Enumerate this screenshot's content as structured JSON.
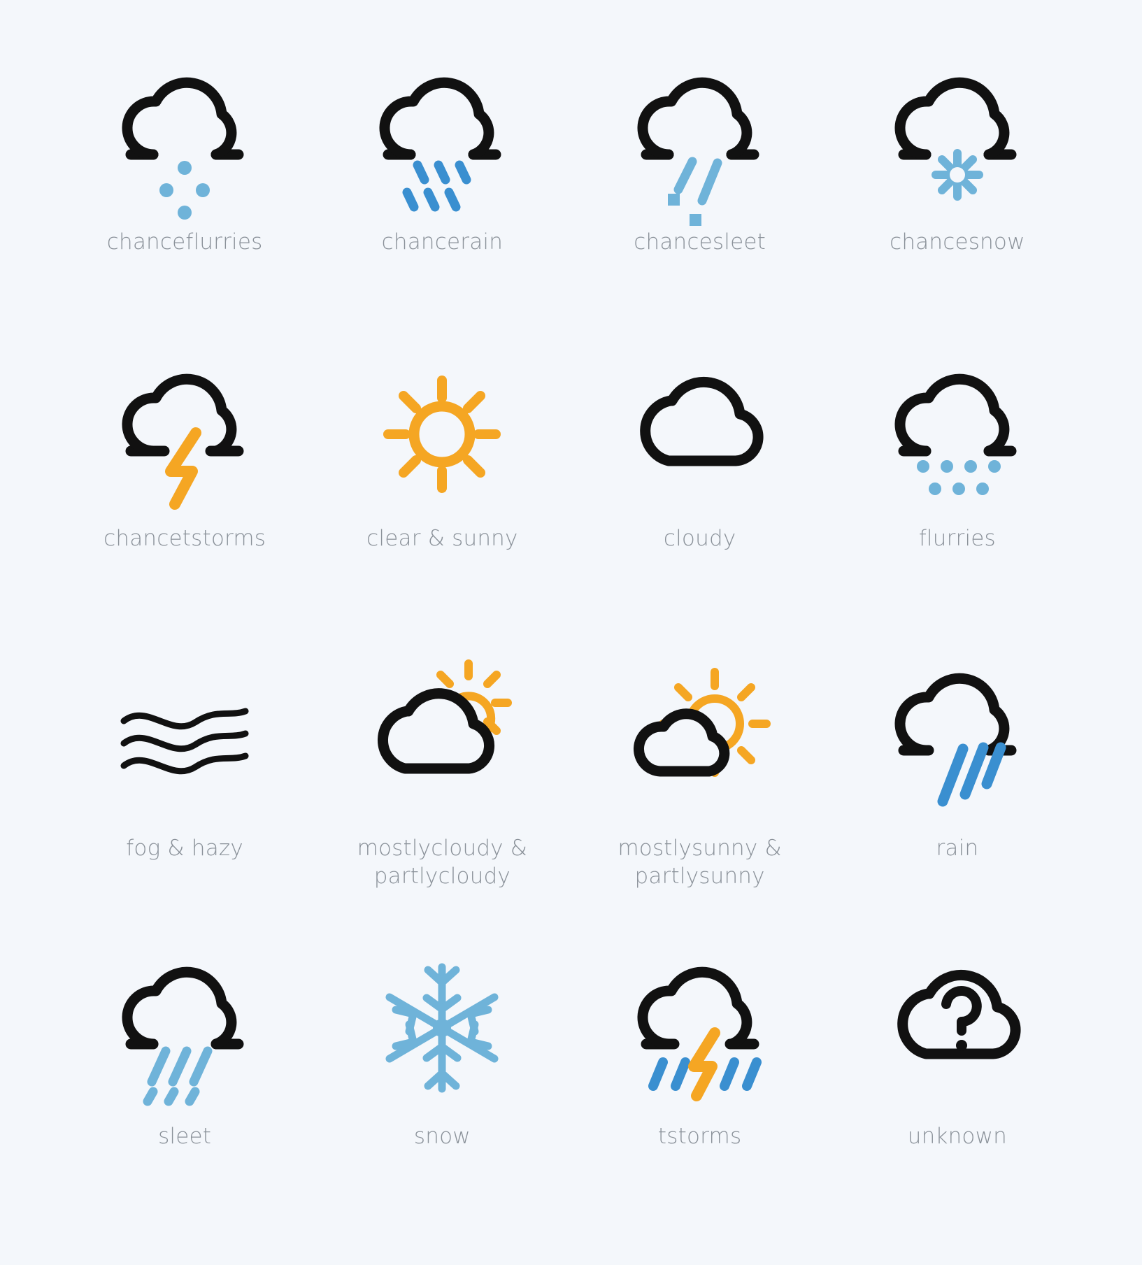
{
  "page": {
    "title": "Weather icon set",
    "background_color": "#f4f7fb",
    "label_color": "#8a9199",
    "columns": 4,
    "rows": 4,
    "icon_count": 16
  },
  "colors": {
    "outline": "#111111",
    "rain_blue": "#3a8fd0",
    "snow_blue": "#6fb3d9",
    "sun_amber": "#f5a623",
    "bolt_amber": "#f5a623",
    "label_gray": "#8a9199",
    "background": "#f4f7fb"
  },
  "icons": [
    {
      "id": "chanceflurries",
      "label": "chanceflurries",
      "label_lines": [
        "chanceflurries"
      ],
      "glyph": "cloud-with-snow-dots-icon",
      "accent": "#6fb3d9"
    },
    {
      "id": "chancerain",
      "label": "chancerain",
      "label_lines": [
        "chancerain"
      ],
      "glyph": "cloud-with-rain-dashes-icon",
      "accent": "#3a8fd0"
    },
    {
      "id": "chancesleet",
      "label": "chancesleet",
      "label_lines": [
        "chancesleet"
      ],
      "glyph": "cloud-with-sleet-icon",
      "accent": "#6fb3d9"
    },
    {
      "id": "chancesnow",
      "label": "chancesnow",
      "label_lines": [
        "chancesnow"
      ],
      "glyph": "cloud-with-small-snowflake-icon",
      "accent": "#6fb3d9"
    },
    {
      "id": "chancetstorms",
      "label": "chancetstorms",
      "label_lines": [
        "chancetstorms"
      ],
      "glyph": "cloud-with-lightning-icon",
      "accent": "#f5a623"
    },
    {
      "id": "clear",
      "label": "clear & sunny",
      "label_lines": [
        "clear & sunny"
      ],
      "glyph": "sun-icon",
      "accent": "#f5a623"
    },
    {
      "id": "cloudy",
      "label": "cloudy",
      "label_lines": [
        "cloudy"
      ],
      "glyph": "cloud-icon",
      "accent": "#111111"
    },
    {
      "id": "flurries",
      "label": "flurries",
      "label_lines": [
        "flurries"
      ],
      "glyph": "cloud-with-many-snow-dots-icon",
      "accent": "#6fb3d9"
    },
    {
      "id": "fog",
      "label": "fog & hazy",
      "label_lines": [
        "fog & hazy"
      ],
      "glyph": "fog-waves-icon",
      "accent": "#111111"
    },
    {
      "id": "mostlycloudy",
      "label": "mostlycloudy & partlycloudy",
      "label_lines": [
        "mostlycloudy &",
        "partlycloudy"
      ],
      "glyph": "sun-behind-cloud-icon",
      "accent": "#f5a623"
    },
    {
      "id": "mostlysunny",
      "label": "mostlysunny & partlysunny",
      "label_lines": [
        "mostlysunny &",
        "partlysunny"
      ],
      "glyph": "sun-with-small-cloud-icon",
      "accent": "#f5a623"
    },
    {
      "id": "rain",
      "label": "rain",
      "label_lines": [
        "rain"
      ],
      "glyph": "cloud-with-heavy-rain-icon",
      "accent": "#3a8fd0"
    },
    {
      "id": "sleet",
      "label": "sleet",
      "label_lines": [
        "sleet"
      ],
      "glyph": "cloud-with-sleet-dashes-icon",
      "accent": "#6fb3d9"
    },
    {
      "id": "snow",
      "label": "snow",
      "label_lines": [
        "snow"
      ],
      "glyph": "snowflake-icon",
      "accent": "#6fb3d9"
    },
    {
      "id": "tstorms",
      "label": "tstorms",
      "label_lines": [
        "tstorms"
      ],
      "glyph": "cloud-with-lightning-and-rain-icon",
      "accent": "#f5a623"
    },
    {
      "id": "unknown",
      "label": "unknown",
      "label_lines": [
        "unknown"
      ],
      "glyph": "cloud-with-question-mark-icon",
      "accent": "#111111"
    }
  ]
}
